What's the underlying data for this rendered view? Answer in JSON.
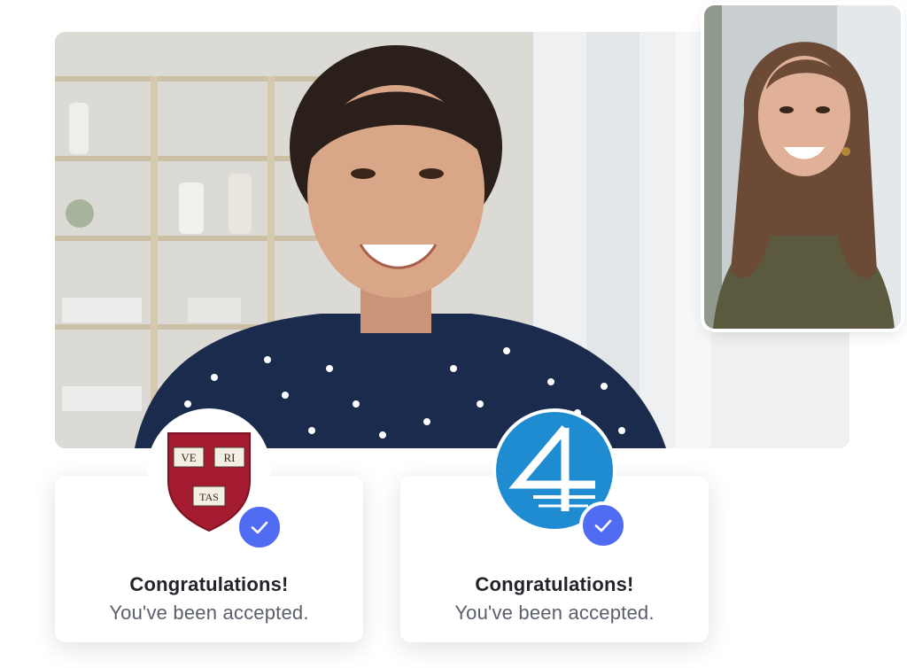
{
  "cards": [
    {
      "title": "Congratulations!",
      "subtitle": "You've been accepted.",
      "logo": "harvard-shield-logo",
      "logo_text": [
        "VE",
        "RI",
        "TAS"
      ],
      "badge_icon": "check-icon"
    },
    {
      "title": "Congratulations!",
      "subtitle": "You've been accepted.",
      "logo": "blue-circle-4-logo",
      "badge_icon": "check-icon"
    }
  ],
  "colors": {
    "badge_blue": "#4f6cf2",
    "logo_blue": "#1f8bd0",
    "crimson": "#a51c30",
    "title_text": "#23232b",
    "subtitle_text": "#5b5f6b"
  },
  "videos": {
    "main": "smiling-woman-video",
    "secondary": "smiling-woman-long-hair-video"
  }
}
